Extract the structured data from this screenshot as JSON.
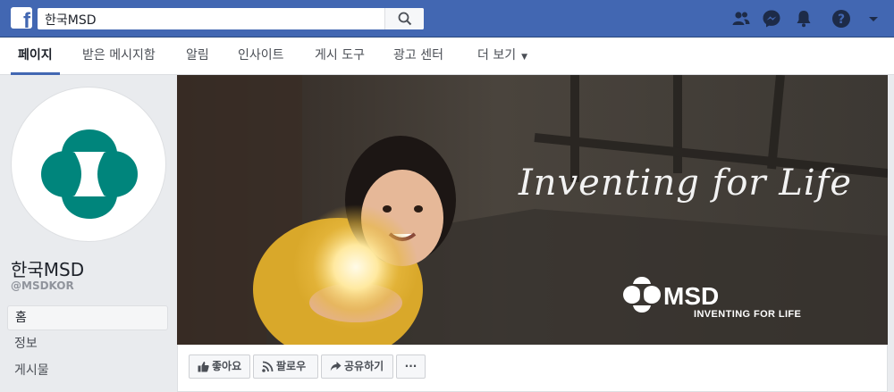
{
  "colors": {
    "brand_blue": "#4267b2",
    "msd_teal": "#00857c"
  },
  "topbar": {
    "search_value": "한국MSD",
    "icons": [
      "facebook-logo-icon",
      "search-icon",
      "friends-icon",
      "messenger-icon",
      "notifications-icon",
      "help-icon",
      "account-menu-caret-icon"
    ]
  },
  "tabs": [
    {
      "label": "페이지"
    },
    {
      "label": "받은 메시지함"
    },
    {
      "label": "알림"
    },
    {
      "label": "인사이트"
    },
    {
      "label": "게시 도구"
    },
    {
      "label": "광고 센터"
    },
    {
      "label": "더 보기"
    }
  ],
  "page": {
    "name": "한국MSD",
    "handle": "@MSDKOR"
  },
  "left_nav": [
    {
      "label": "홈"
    },
    {
      "label": "정보"
    },
    {
      "label": "게시물"
    }
  ],
  "cover": {
    "slogan": "Inventing for Life",
    "brand": "MSD",
    "brand_sub": "INVENTING FOR LIFE"
  },
  "actions": {
    "like": "좋아요",
    "follow": "팔로우",
    "share": "공유하기",
    "more": "···"
  }
}
